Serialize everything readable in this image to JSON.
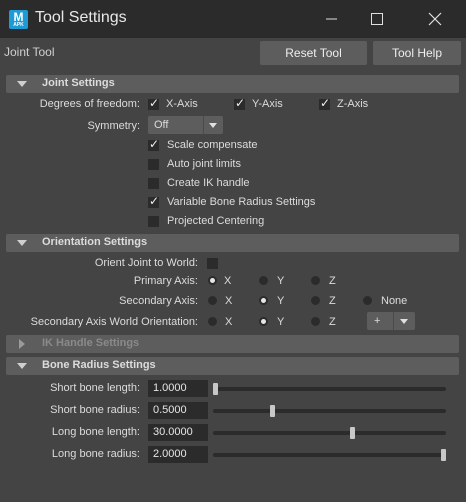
{
  "window": {
    "app_icon_letter": "M",
    "app_icon_sub": "APK",
    "title": "Tool Settings"
  },
  "toolbar": {
    "tool_name": "Joint Tool",
    "reset_label": "Reset Tool",
    "help_label": "Tool Help"
  },
  "joint_settings": {
    "header": "Joint Settings",
    "dof_label": "Degrees of freedom:",
    "dof": [
      {
        "label": "X-Axis",
        "checked": true
      },
      {
        "label": "Y-Axis",
        "checked": true
      },
      {
        "label": "Z-Axis",
        "checked": true
      }
    ],
    "symmetry_label": "Symmetry:",
    "symmetry_value": "Off",
    "options": [
      {
        "label": "Scale compensate",
        "checked": true
      },
      {
        "label": "Auto joint limits",
        "checked": false
      },
      {
        "label": "Create IK handle",
        "checked": false
      },
      {
        "label": "Variable Bone Radius Settings",
        "checked": true
      },
      {
        "label": "Projected Centering",
        "checked": false
      }
    ]
  },
  "orientation_settings": {
    "header": "Orientation Settings",
    "orient_to_world_label": "Orient Joint to World:",
    "primary_axis_label": "Primary Axis:",
    "primary_axis": [
      "X",
      "Y",
      "Z"
    ],
    "primary_selected": "X",
    "secondary_axis_label": "Secondary Axis:",
    "secondary_axis": [
      "X",
      "Y",
      "Z",
      "None"
    ],
    "secondary_selected": "Y",
    "secondary_world_label": "Secondary Axis World Orientation:",
    "secondary_world": [
      "X",
      "Y",
      "Z"
    ],
    "secondary_world_selected": "Y",
    "sign_value": "+"
  },
  "ik_handle_settings": {
    "header": "IK Handle Settings"
  },
  "bone_radius_settings": {
    "header": "Bone Radius Settings",
    "rows": [
      {
        "label": "Short bone length:",
        "value": "1.0000",
        "slider": 0.0
      },
      {
        "label": "Short bone radius:",
        "value": "0.5000",
        "slider": 0.25
      },
      {
        "label": "Long bone length:",
        "value": "30.0000",
        "slider": 0.6
      },
      {
        "label": "Long bone radius:",
        "value": "2.0000",
        "slider": 1.0
      }
    ]
  },
  "colors": {
    "background": "#444444",
    "titlebar": "#2b2b2b",
    "section_header": "#5d5d5d",
    "field": "#2b2b2b",
    "accent_icon": "#1e9bd6"
  }
}
